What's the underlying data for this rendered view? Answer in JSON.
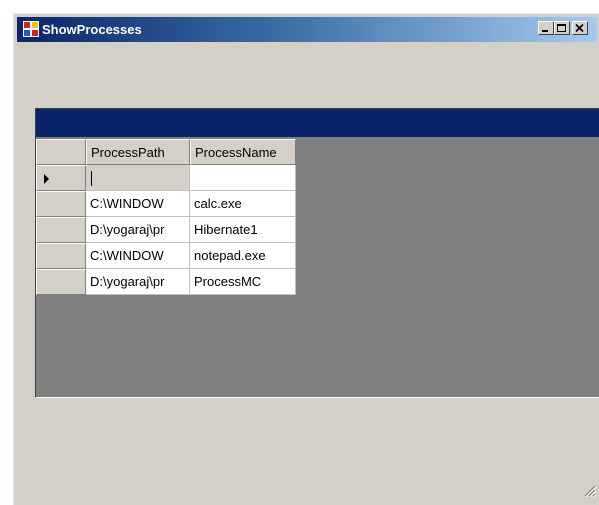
{
  "window": {
    "title": "ShowProcesses",
    "icon": "form-app-icon",
    "controls": [
      "minimize-button",
      "maximize-button",
      "close-button"
    ]
  },
  "grid": {
    "caption_color": "#0a246a",
    "columns": [
      "ProcessPath",
      "ProcessName"
    ],
    "new_row": {
      "ProcessPath": "",
      "ProcessName": ""
    },
    "rows": [
      {
        "ProcessPath": "C:\\WINDOW",
        "ProcessName": "calc.exe"
      },
      {
        "ProcessPath": "D:\\yogaraj\\pr",
        "ProcessName": "Hibernate1"
      },
      {
        "ProcessPath": "C:\\WINDOW",
        "ProcessName": "notepad.exe"
      },
      {
        "ProcessPath": "D:\\yogaraj\\pr",
        "ProcessName": "ProcessMC"
      }
    ]
  }
}
